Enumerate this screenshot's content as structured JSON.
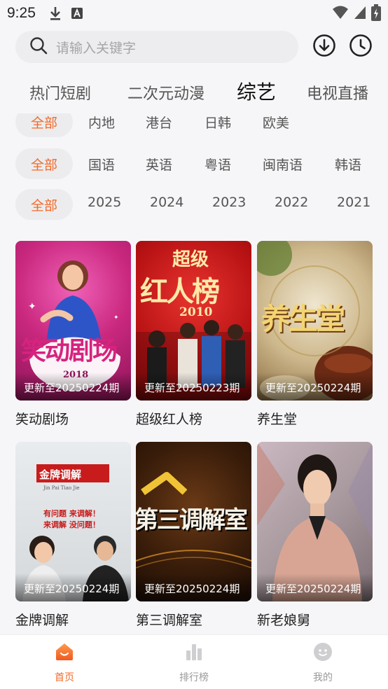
{
  "status_bar": {
    "time": "9:25",
    "icons": [
      "download-icon",
      "a-icon",
      "wifi-icon",
      "signal-icon",
      "battery-icon"
    ]
  },
  "search": {
    "placeholder": "请输入关键字",
    "icon": "search-icon",
    "download_icon": "download-icon",
    "history_icon": "clock-icon"
  },
  "tabs": [
    {
      "label": "热门短剧"
    },
    {
      "label": "二次元动漫"
    },
    {
      "label": "综艺",
      "active": true
    },
    {
      "label": "电视直播"
    }
  ],
  "filters": {
    "region": [
      "全部",
      "内地",
      "港台",
      "日韩",
      "欧美"
    ],
    "language": [
      "全部",
      "国语",
      "英语",
      "粤语",
      "闽南语",
      "韩语"
    ],
    "year": [
      "全部",
      "2025",
      "2024",
      "2023",
      "2022",
      "2021"
    ]
  },
  "shows": [
    {
      "title": "笑动剧场",
      "update": "更新至20250224期",
      "poster_text": "笑动剧场",
      "poster_sub": "2018"
    },
    {
      "title": "超级红人榜",
      "update": "更新至20250223期",
      "poster_text": "超级",
      "poster_text2": "红人榜",
      "poster_sub": "2010"
    },
    {
      "title": "养生堂",
      "update": "更新至20250224期",
      "poster_text": "养生堂"
    },
    {
      "title": "金牌调解",
      "update": "更新至20250224期",
      "poster_text": "金牌调解",
      "poster_sub": "Jin Pai  Tiao Jie",
      "poster_line1": "有问题 来调解！",
      "poster_line2": "来调解 没问题！"
    },
    {
      "title": "第三调解室",
      "update": "更新至20250224期",
      "poster_text": "第三调解室"
    },
    {
      "title": "新老娘舅",
      "update": "更新至20250224期"
    }
  ],
  "bottom_nav": [
    {
      "label": "首页",
      "icon": "home-icon",
      "active": true
    },
    {
      "label": "排行榜",
      "icon": "chart-icon"
    },
    {
      "label": "我的",
      "icon": "profile-icon"
    }
  ],
  "colors": {
    "accent": "#f26b2a",
    "background": "#f6f6f8"
  }
}
